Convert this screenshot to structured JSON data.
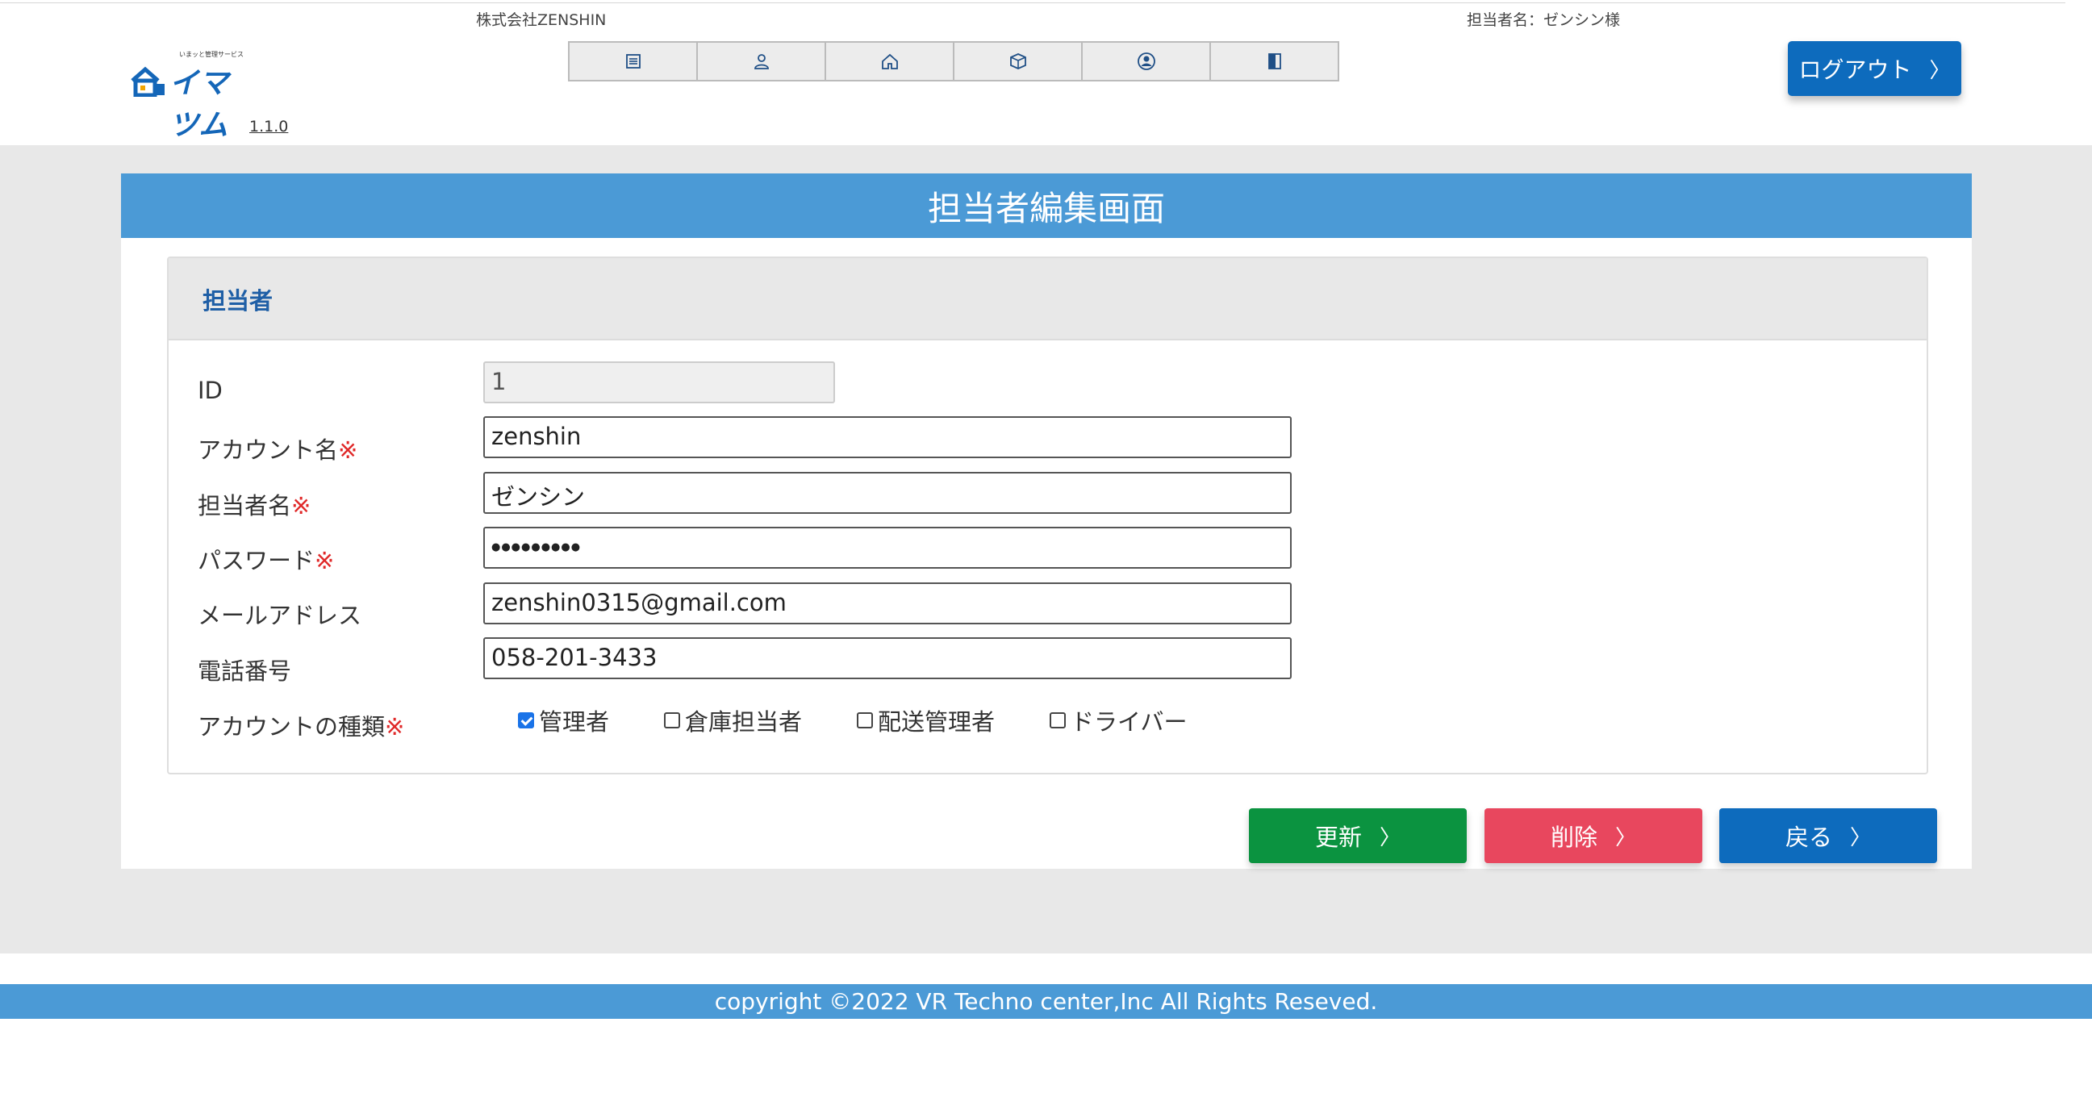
{
  "header": {
    "company": "株式会社ZENSHIN",
    "staff": "担当者名：ゼンシン様",
    "logo": {
      "tagline": "いまッと管理サービス",
      "brand": "イマツム"
    },
    "version": "1.1.0",
    "nav_icons": [
      "list-icon",
      "user-icon",
      "home-icon",
      "box-icon",
      "user-circle-icon",
      "book-icon"
    ],
    "logout_label": "ログアウト"
  },
  "page_title": "担当者編集画面",
  "section_title": "担当者",
  "form": {
    "id": {
      "label": "ID",
      "value": "1"
    },
    "account": {
      "label": "アカウント名",
      "required_mark": "※",
      "value": "zenshin"
    },
    "name": {
      "label": "担当者名",
      "required_mark": "※",
      "value": "ゼンシン"
    },
    "password": {
      "label": "パスワード",
      "required_mark": "※",
      "value": "●●●●●●●●●"
    },
    "email": {
      "label": "メールアドレス",
      "value": "zenshin0315@gmail.com"
    },
    "phone": {
      "label": "電話番号",
      "value": "058-201-3433"
    },
    "account_type": {
      "label": "アカウントの種類",
      "required_mark": "※",
      "options": [
        {
          "label": "管理者",
          "checked": true
        },
        {
          "label": "倉庫担当者",
          "checked": false
        },
        {
          "label": "配送管理者",
          "checked": false
        },
        {
          "label": "ドライバー",
          "checked": false
        }
      ]
    }
  },
  "buttons": {
    "update": "更新",
    "delete": "削除",
    "back": "戻る",
    "chevron": "〉"
  },
  "footer": "copyright ©2022 VR Techno center,Inc All Rights Reseved.",
  "colors": {
    "primary": "#0d6bbd",
    "title_bar": "#4b9ad6",
    "update": "#0b9340",
    "delete": "#e8475e",
    "required": "#e02828"
  }
}
